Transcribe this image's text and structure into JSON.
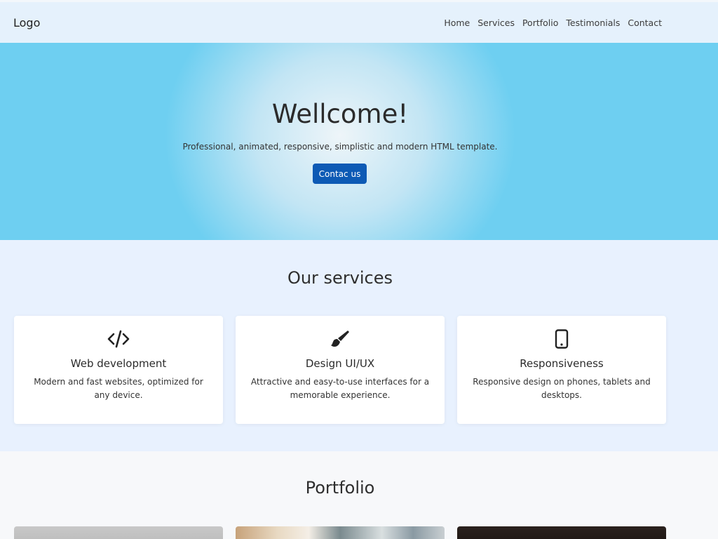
{
  "header": {
    "logo": "Logo",
    "nav": [
      "Home",
      "Services",
      "Portfolio",
      "Testimonials",
      "Contact"
    ]
  },
  "hero": {
    "title": "Wellcome!",
    "subtitle": "Professional, animated, responsive, simplistic and modern HTML template.",
    "cta_label": "Contac us",
    "cta_color": "#0d5ab5"
  },
  "services": {
    "title": "Our services",
    "items": [
      {
        "icon": "code-icon",
        "title": "Web development",
        "text": "Modern and fast websites, optimized for any device."
      },
      {
        "icon": "paintbrush-icon",
        "title": "Design UI/UX",
        "text": "Attractive and easy-to-use interfaces for a memorable experience."
      },
      {
        "icon": "mobile-phone-icon",
        "title": "Responsiveness",
        "text": "Responsive design on phones, tablets and desktops."
      }
    ]
  },
  "portfolio": {
    "title": "Portfolio"
  }
}
